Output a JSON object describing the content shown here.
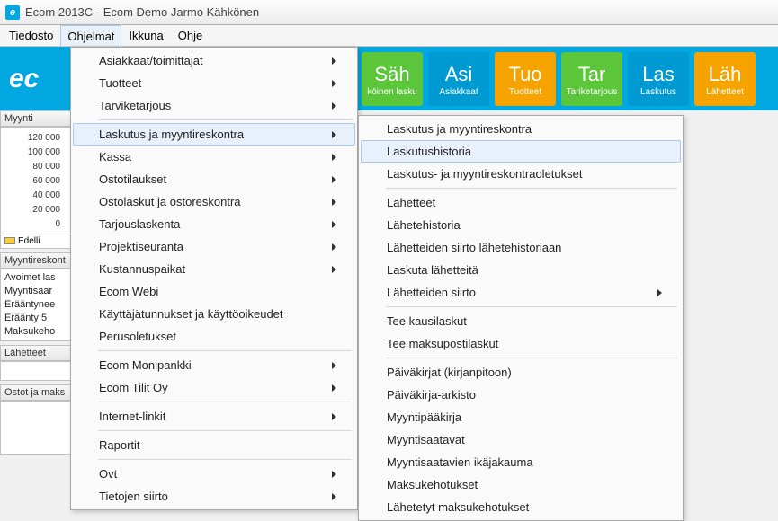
{
  "window": {
    "title": "Ecom 2013C - Ecom Demo Jarmo Kähkönen"
  },
  "menubar": {
    "items": [
      "Tiedosto",
      "Ohjelmat",
      "Ikkuna",
      "Ohje"
    ],
    "open_index": 1
  },
  "toolbar": {
    "logo_text": "ec",
    "tiles": [
      {
        "big": "Säh",
        "small": "köinen lasku",
        "color": "green"
      },
      {
        "big": "Asi",
        "small": "Asiakkaat",
        "color": "blue"
      },
      {
        "big": "Tuo",
        "small": "Tuotteet",
        "color": "orange"
      },
      {
        "big": "Tar",
        "small": "Tariketarjous",
        "color": "green"
      },
      {
        "big": "Las",
        "small": "Laskutus",
        "color": "blue"
      },
      {
        "big": "Läh",
        "small": "Lähetteet",
        "color": "orange"
      }
    ]
  },
  "left_panels": {
    "sales": {
      "title": "Myynti",
      "y_ticks": [
        "120 000",
        "100 000",
        "80 000",
        "60 000",
        "40 000",
        "20 000",
        "0"
      ],
      "legend": "Edelli"
    },
    "receivables": {
      "title": "Myyntireskont",
      "rows": [
        "Avoimet las",
        "Myyntisaar",
        "Erääntynee",
        "Eräänty 5",
        "Maksukeho"
      ]
    },
    "deliveries": {
      "title": "Lähetteet"
    },
    "purchases": {
      "title": "Ostot ja maks"
    }
  },
  "menu1": {
    "groups": [
      {
        "items": [
          {
            "label": "Asiakkaat/toimittajat",
            "arrow": true
          },
          {
            "label": "Tuotteet",
            "arrow": true
          },
          {
            "label": "Tarviketarjous",
            "arrow": true
          }
        ]
      },
      {
        "items": [
          {
            "label": "Laskutus ja myyntireskontra",
            "arrow": true,
            "highlight": true
          },
          {
            "label": "Kassa",
            "arrow": true
          },
          {
            "label": "Ostotilaukset",
            "arrow": true
          },
          {
            "label": "Ostolaskut ja ostoreskontra",
            "arrow": true
          },
          {
            "label": "Tarjouslaskenta",
            "arrow": true
          },
          {
            "label": "Projektiseuranta",
            "arrow": true
          },
          {
            "label": "Kustannuspaikat",
            "arrow": true
          },
          {
            "label": "Ecom Webi",
            "arrow": false
          },
          {
            "label": "Käyttäjätunnukset ja käyttöoikeudet",
            "arrow": false
          },
          {
            "label": "Perusoletukset",
            "arrow": false
          }
        ]
      },
      {
        "items": [
          {
            "label": "Ecom Monipankki",
            "arrow": true
          },
          {
            "label": "Ecom Tilit Oy",
            "arrow": true
          }
        ]
      },
      {
        "items": [
          {
            "label": "Internet-linkit",
            "arrow": true
          }
        ]
      },
      {
        "items": [
          {
            "label": "Raportit",
            "arrow": false
          }
        ]
      },
      {
        "items": [
          {
            "label": "Ovt",
            "arrow": true
          },
          {
            "label": "Tietojen siirto",
            "arrow": true
          }
        ]
      }
    ]
  },
  "menu2": {
    "groups": [
      {
        "items": [
          {
            "label": "Laskutus ja myyntireskontra",
            "arrow": false
          },
          {
            "label": "Laskutushistoria",
            "arrow": false,
            "highlight": true
          },
          {
            "label": "Laskutus- ja myyntireskontraoletukset",
            "arrow": false
          }
        ]
      },
      {
        "items": [
          {
            "label": "Lähetteet",
            "arrow": false
          },
          {
            "label": "Lähetehistoria",
            "arrow": false
          },
          {
            "label": "Lähetteiden siirto lähetehistoriaan",
            "arrow": false
          },
          {
            "label": "Laskuta lähetteitä",
            "arrow": false
          },
          {
            "label": "Lähetteiden siirto",
            "arrow": true
          }
        ]
      },
      {
        "items": [
          {
            "label": "Tee kausilaskut",
            "arrow": false
          },
          {
            "label": "Tee maksupostilaskut",
            "arrow": false
          }
        ]
      },
      {
        "items": [
          {
            "label": "Päiväkirjat (kirjanpitoon)",
            "arrow": false
          },
          {
            "label": "Päiväkirja-arkisto",
            "arrow": false
          },
          {
            "label": "Myyntipääkirja",
            "arrow": false
          },
          {
            "label": "Myyntisaatavat",
            "arrow": false
          },
          {
            "label": "Myyntisaatavien ikäjakauma",
            "arrow": false
          },
          {
            "label": "Maksukehotukset",
            "arrow": false
          },
          {
            "label": "Lähetetyt maksukehotukset",
            "arrow": false
          }
        ]
      }
    ]
  }
}
